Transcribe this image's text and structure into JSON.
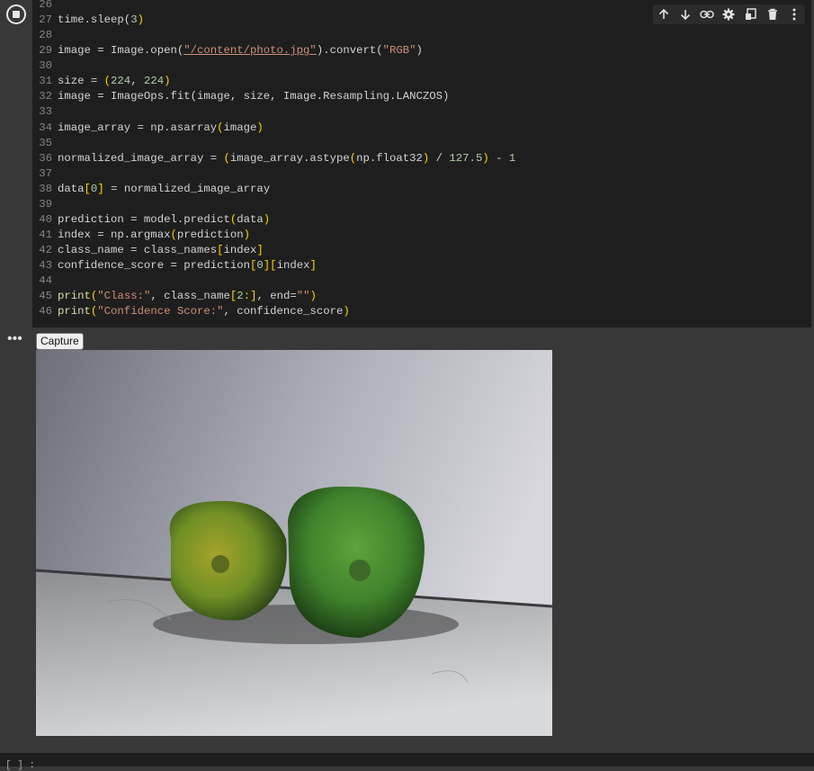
{
  "code": {
    "lines": [
      {
        "num": "26"
      },
      {
        "num": "27"
      },
      {
        "num": "28"
      },
      {
        "num": "29"
      },
      {
        "num": "30"
      },
      {
        "num": "31"
      },
      {
        "num": "32"
      },
      {
        "num": "33"
      },
      {
        "num": "34"
      },
      {
        "num": "35"
      },
      {
        "num": "36"
      },
      {
        "num": "37"
      },
      {
        "num": "38"
      },
      {
        "num": "39"
      },
      {
        "num": "40"
      },
      {
        "num": "41"
      },
      {
        "num": "42"
      },
      {
        "num": "43"
      },
      {
        "num": "44"
      },
      {
        "num": "45"
      },
      {
        "num": "46"
      }
    ],
    "t27a": "time.sleep(",
    "t27n": "3",
    "t27b": ")",
    "t29a": "image = Image.open(",
    "t29s": "\"/content/photo.jpg\"",
    "t29b": ").convert(",
    "t29s2": "\"RGB\"",
    "t29c": ")",
    "t31a": "size = ",
    "t31b": "(",
    "t31n1": "224",
    "t31c": ", ",
    "t31n2": "224",
    "t31d": ")",
    "t32": "image = ImageOps.fit(image, size, Image.Resampling.LANCZOS)",
    "t34a": "image_array = np.asarray",
    "t34b": "(",
    "t34c": "image",
    "t34d": ")",
    "t36a": "normalized_image_array = ",
    "t36b": "(",
    "t36c": "image_array.astype",
    "t36d": "(",
    "t36e": "np.float32",
    "t36f": ")",
    "t36g": " / ",
    "t36n": "127.5",
    "t36h": ")",
    "t36i": " - ",
    "t36n2": "1",
    "t38a": "data",
    "t38b": "[",
    "t38n": "0",
    "t38c": "]",
    "t38d": " = normalized_image_array",
    "t40a": "prediction = model.predict",
    "t40b": "(",
    "t40c": "data",
    "t40d": ")",
    "t41a": "index = np.argmax",
    "t41b": "(",
    "t41c": "prediction",
    "t41d": ")",
    "t42a": "class_name = class_names",
    "t42b": "[",
    "t42c": "index",
    "t42d": "]",
    "t43a": "confidence_score = prediction",
    "t43b": "[",
    "t43n": "0",
    "t43c": "][",
    "t43d": "index",
    "t43e": "]",
    "t45a": "print",
    "t45b": "(",
    "t45s": "\"Class:\"",
    "t45c": ", class_name",
    "t45d": "[",
    "t45n": "2",
    "t45e": ":]",
    "t45f": ", end=",
    "t45s2": "\"\"",
    "t45g": ")",
    "t46a": "print",
    "t46b": "(",
    "t46s": "\"Confidence Score:\"",
    "t46c": ", confidence_score",
    "t46d": ")"
  },
  "toolbar": {
    "icons": [
      "arrow-up-icon",
      "arrow-down-icon",
      "link-icon",
      "gear-icon",
      "mirror-cell-icon",
      "trash-icon",
      "more-vert-icon"
    ]
  },
  "output": {
    "menu_label": "•••",
    "capture_label": "Capture"
  },
  "bottom_cell": {
    "label": "[ ]  :"
  },
  "colors": {
    "editor_bg": "#1e1e1e",
    "page_bg": "#383838",
    "string": "#ce9178",
    "number": "#b5cea8",
    "bracket": "#ffd700"
  }
}
